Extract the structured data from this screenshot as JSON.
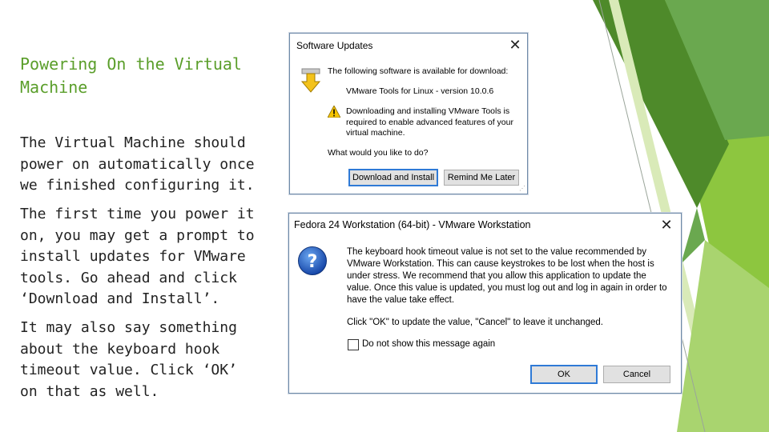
{
  "slide": {
    "title": "Powering On the Virtual Machine",
    "para1": "The Virtual Machine should power on automatically once we finished configuring it.",
    "para2": "The first time you power it on, you may get a prompt to install updates for VMware tools. Go ahead and click ‘Download and Install’.",
    "para3": "It may also say something about the keyboard hook timeout value. Click ‘OK’ on that as well."
  },
  "software_updates": {
    "title": "Software Updates",
    "heading": "The following software is available for download:",
    "package": "VMware Tools for Linux - version 10.0.6",
    "warning": "Downloading and installing VMware Tools is required to enable advanced features of your virtual machine.",
    "question": "What would you like to do?",
    "download_label": "Download and Install",
    "remind_label": "Remind Me Later"
  },
  "vmware_dialog": {
    "title": "Fedora 24 Workstation (64-bit) - VMware Workstation",
    "message": "The keyboard hook timeout value is not set to the value recommended by VMware Workstation. This can cause keystrokes to be lost when the host is under stress. We recommend that you allow this application to update the value.  Once this value is updated, you must log out and log in again in order to have the value take effect.",
    "instruction": "Click \"OK\" to update the value, \"Cancel\" to leave it unchanged.",
    "checkbox_label": "Do not show this message again",
    "ok_label": "OK",
    "cancel_label": "Cancel"
  },
  "colors": {
    "title_green": "#5a9e2a",
    "accent_green": "#8dc63f",
    "dark_green": "#4e8a2a",
    "button_border_blue": "#2f7ad6"
  },
  "icons": [
    "download-arrow-icon",
    "warning-icon",
    "question-icon",
    "close-icon"
  ]
}
